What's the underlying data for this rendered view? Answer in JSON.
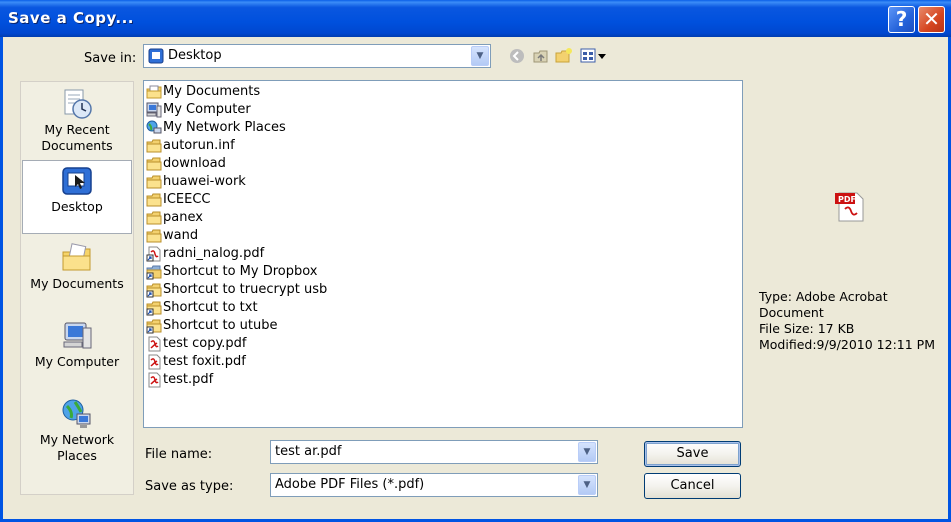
{
  "window": {
    "title": "Save a Copy..."
  },
  "titlebar": {
    "help_glyph": "?",
    "close_glyph": "✕"
  },
  "save_in": {
    "label": "Save in:",
    "value": "Desktop"
  },
  "places": [
    {
      "line1": "My Recent",
      "line2": "Documents",
      "icon": "recent-documents-icon"
    },
    {
      "line1": "Desktop",
      "line2": "",
      "icon": "desktop-icon",
      "selected": true
    },
    {
      "line1": "My Documents",
      "line2": "",
      "icon": "my-documents-icon"
    },
    {
      "line1": "My Computer",
      "line2": "",
      "icon": "my-computer-icon"
    },
    {
      "line1": "My Network",
      "line2": "Places",
      "icon": "network-places-icon"
    }
  ],
  "files": [
    {
      "name": "My Documents",
      "type": "mydocs"
    },
    {
      "name": "My Computer",
      "type": "computer"
    },
    {
      "name": "My Network Places",
      "type": "network"
    },
    {
      "name": "autorun.inf",
      "type": "folder"
    },
    {
      "name": "download",
      "type": "folder"
    },
    {
      "name": "huawei-work",
      "type": "folder"
    },
    {
      "name": "ICEECC",
      "type": "folder"
    },
    {
      "name": "panex",
      "type": "folder"
    },
    {
      "name": "wand",
      "type": "folder"
    },
    {
      "name": "radni_nalog.pdf",
      "type": "pdf-shortcut"
    },
    {
      "name": "Shortcut to My Dropbox",
      "type": "folder-shortcut"
    },
    {
      "name": "Shortcut to truecrypt usb",
      "type": "folder-shortcut"
    },
    {
      "name": "Shortcut to txt",
      "type": "folder-shortcut"
    },
    {
      "name": "Shortcut to utube",
      "type": "folder-shortcut"
    },
    {
      "name": "test copy.pdf",
      "type": "pdf"
    },
    {
      "name": "test foxit.pdf",
      "type": "pdf"
    },
    {
      "name": "test.pdf",
      "type": "pdf"
    }
  ],
  "preview": {
    "icon_label": "PDF",
    "type": "Type: Adobe Acrobat",
    "type_cont": "Document",
    "size": "File Size: 17 KB",
    "modified": "Modified:9/9/2010 12:11 PM"
  },
  "file_name": {
    "label": "File name:",
    "value": "test ar.pdf"
  },
  "save_as_type": {
    "label": "Save as type:",
    "value": "Adobe PDF Files (*.pdf)"
  },
  "buttons": {
    "save": "Save",
    "cancel": "Cancel"
  },
  "colors": {
    "titlebar": "#0054E3",
    "dialog_bg": "#ECE9D8",
    "close_red": "#D5451F",
    "pdf_red": "#CC1111"
  }
}
